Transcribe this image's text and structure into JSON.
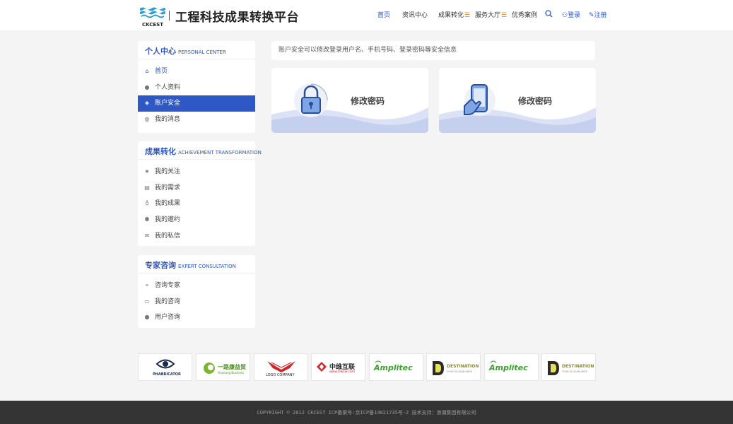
{
  "header": {
    "logo_text": "CKCEST",
    "site_title": "工程科技成果转换平台",
    "nav": [
      "首页",
      "资讯中心",
      "成果转化",
      "服务大厅",
      "优秀案例"
    ],
    "login": "登录",
    "register": "注册"
  },
  "sidebar": {
    "personal": {
      "title": "个人中心",
      "subtitle": "PERSONAL CENTER",
      "items": [
        "首页",
        "个人资料",
        "账户安全",
        "我的消息"
      ]
    },
    "achievement": {
      "title": "成果转化",
      "subtitle": "ACHIEVEMENT TRANSFORMATION",
      "items": [
        "我的关注",
        "我的需求",
        "我的成果",
        "我的邀约",
        "我的私信"
      ]
    },
    "expert": {
      "title": "专家咨询",
      "subtitle": "EXPERT CONSULTATION",
      "items": [
        "咨询专家",
        "我的咨询",
        "用户咨询"
      ]
    }
  },
  "main": {
    "info": "账户安全可以修改登录用户名、手机号码、登录密码等安全信息",
    "cards": [
      {
        "label": "修改密码",
        "icon": "lock-icon"
      },
      {
        "label": "修改密码",
        "icon": "phone-icon"
      }
    ]
  },
  "partners": {
    "items": [
      {
        "name": "PHABRICATOR"
      },
      {
        "name": "一路康益贸",
        "sub": "Yiluleang Business"
      },
      {
        "name": "LOGO COMPANY"
      },
      {
        "name": "中维互联",
        "sub": "www.zlwsw.com"
      },
      {
        "name": "Amplitec"
      },
      {
        "name": "DESTINATION",
        "sub": "YOUR SLOGAN HERE"
      },
      {
        "name": "Amplitec"
      },
      {
        "name": "DESTINATION",
        "sub": "YOUR SLOGAN HERE"
      }
    ]
  },
  "footer": {
    "text": "COPYRIGHT © 2012 CKCEST ICP备案号:京ICP备14021735号-2  技术支持：浪潮集团有限公司"
  },
  "colors": {
    "accent": "#2e58c6",
    "wave": "#c9d3ef",
    "footer": "#343434"
  }
}
